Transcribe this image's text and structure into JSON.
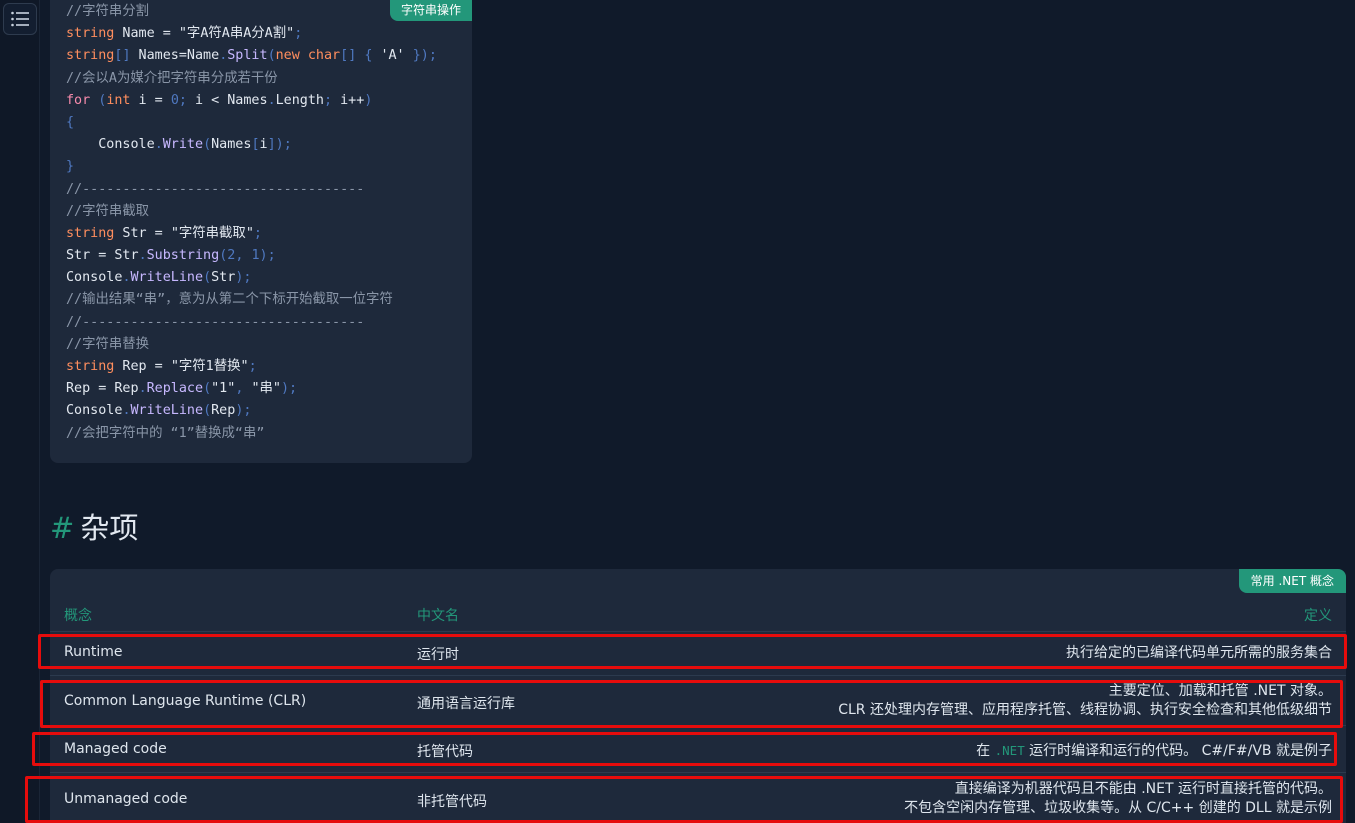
{
  "toc": {
    "icon": "list-icon"
  },
  "code": {
    "tag": "字符串操作",
    "lines": [
      "//字符串分割",
      "string Name = \"字A符A串A分A割\";",
      "string[] Names=Name.Split(new char[] { 'A' });",
      "//会以A为媒介把字符串分成若干份",
      "for (int i = 0; i < Names.Length; i++)",
      "{",
      "    Console.Write(Names[i]);",
      "}",
      "//-----------------------------------",
      "//字符串截取",
      "string Str = \"字符串截取\";",
      "Str = Str.Substring(2, 1);",
      "Console.WriteLine(Str);",
      "//输出结果“串”，意为从第二个下标开始截取一位字符",
      "//-----------------------------------",
      "//字符串替换",
      "string Rep = \"字符1替换\";",
      "Rep = Rep.Replace(\"1\", \"串\");",
      "Console.WriteLine(Rep);",
      "//会把字符中的 “1”替换成“串”"
    ]
  },
  "section": {
    "hash": "#",
    "title": "杂项"
  },
  "table": {
    "tag": "常用 .NET 概念",
    "headers": {
      "concept": "概念",
      "chinese": "中文名",
      "definition": "定义"
    },
    "rows": [
      {
        "concept": "Runtime",
        "chinese": "运行时",
        "def1": "执行给定的已编译代码单元所需的服务集合",
        "def2": ""
      },
      {
        "concept": "Common Language Runtime (CLR)",
        "chinese": "通用语言运行库",
        "def1": "主要定位、加载和托管 .NET 对象。",
        "def2": "CLR 还处理内存管理、应用程序托管、线程协调、执行安全检查和其他低级细节"
      },
      {
        "concept": "Managed code",
        "chinese": "托管代码",
        "def1_pre": "在 ",
        "def1_code": ".NET",
        "def1_post": " 运行时编译和运行的代码。 C#/F#/VB 就是例子"
      },
      {
        "concept": "Unmanaged code",
        "chinese": "非托管代码",
        "def1": "直接编译为机器代码且不能由 .NET 运行时直接托管的代码。",
        "def2": "不包含空闲内存管理、垃圾收集等。从 C/C++ 创建的 DLL 就是示例"
      }
    ]
  }
}
